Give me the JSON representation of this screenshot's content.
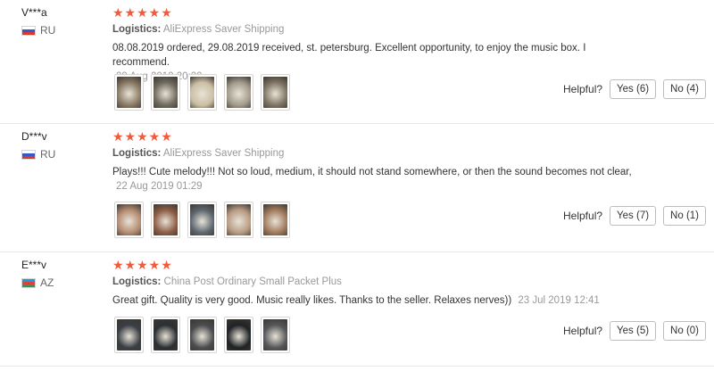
{
  "reviews": [
    {
      "user": "V***a",
      "country": "RU",
      "stars": "★★★★★",
      "logistics_label": "Logistics:",
      "logistics_method": "AliExpress Saver Shipping",
      "text": "08.08.2019 ordered, 29.08.2019 received, st. petersburg. Excellent opportunity, to enjoy the music box. I recommend.",
      "date": "29 Aug 2019 20:20",
      "helpful_label": "Helpful?",
      "yes_label": "Yes (6)",
      "no_label": "No (4)"
    },
    {
      "user": "D***v",
      "country": "RU",
      "stars": "★★★★★",
      "logistics_label": "Logistics:",
      "logistics_method": "AliExpress Saver Shipping",
      "text": "Plays!!! Cute melody!!! Not so loud, medium, it should not stand somewhere, or then the sound becomes not clear,",
      "date": "22 Aug 2019 01:29",
      "helpful_label": "Helpful?",
      "yes_label": "Yes (7)",
      "no_label": "No (1)"
    },
    {
      "user": "E***v",
      "country": "AZ",
      "stars": "★★★★★",
      "logistics_label": "Logistics:",
      "logistics_method": "China Post Ordinary Small Packet Plus",
      "text": "Great gift. Quality is very good. Music really likes. Thanks to the seller. Relaxes nerves))",
      "date": "23 Jul 2019 12:41",
      "helpful_label": "Helpful?",
      "yes_label": "Yes (5)",
      "no_label": "No (0)"
    }
  ],
  "colors": {
    "star": "#f15a3b",
    "muted_text": "#999999",
    "divider": "#e8e8e8"
  },
  "photo_swatches": [
    [
      "#8a7a66",
      "#6f6a5e",
      "#cbbfa4",
      "#a39b8c",
      "#7d7464"
    ],
    [
      "#b58c72",
      "#8c5d45",
      "#5d6670",
      "#b89c84",
      "#a07a5c"
    ],
    [
      "#3a3f45",
      "#2b2f33",
      "#4a4c4f",
      "#1f2326",
      "#55575a"
    ]
  ]
}
